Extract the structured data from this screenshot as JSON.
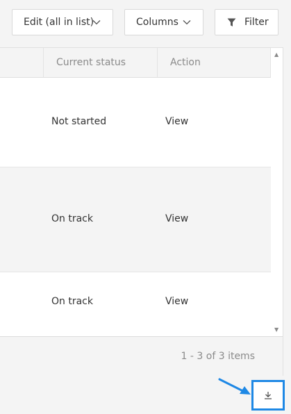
{
  "toolbar": {
    "edit_label": "Edit (all in list)",
    "columns_label": "Columns",
    "filter_label": "Filter"
  },
  "table": {
    "headers": [
      "Current status",
      "Action"
    ],
    "rows": [
      {
        "status": "Not started",
        "action": "View"
      },
      {
        "status": "On track",
        "action": "View"
      },
      {
        "status": "On track",
        "action": "View"
      }
    ]
  },
  "footer": {
    "item_count": "1 - 3 of 3 items"
  },
  "icons": {
    "edit_dropdown": "chevron-down-icon",
    "columns_dropdown": "chevron-down-icon",
    "filter": "funnel-icon",
    "download": "download-icon",
    "scroll_up": "caret-up-icon",
    "scroll_down": "caret-down-icon"
  },
  "colors": {
    "highlight": "#1e88e5",
    "header_text": "#8a8a8a",
    "body_text": "#333333"
  }
}
